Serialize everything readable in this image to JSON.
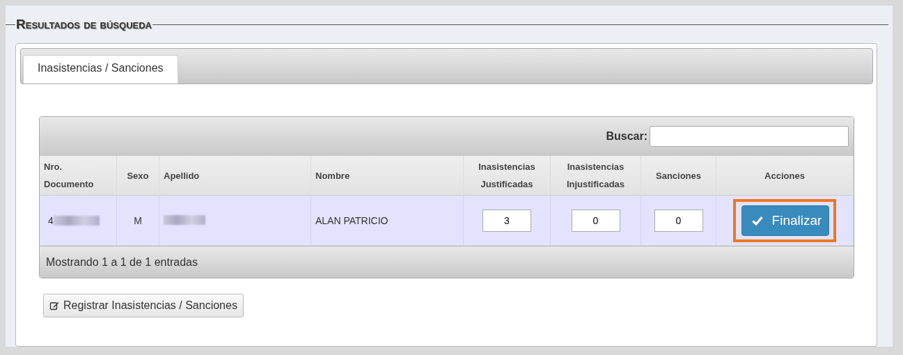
{
  "legend": "Resultados de búsqueda",
  "tabs": [
    {
      "label": "Inasistencias / Sanciones",
      "selected": true
    }
  ],
  "search": {
    "label": "Buscar:"
  },
  "table": {
    "columns": [
      "Nro. Documento",
      "Sexo",
      "Apellido",
      "Nombre",
      "Inasistencias Justificadas",
      "Inasistencias Injustificadas",
      "Sanciones",
      "Acciones"
    ],
    "rows": [
      {
        "documento": "4",
        "documento_redacted": true,
        "sexo": "M",
        "apellido_redacted": true,
        "nombre": "ALAN PATRICIO",
        "justificadas": "3",
        "injustificadas": "0",
        "sanciones": "0",
        "action": {
          "label": "Finalizar",
          "highlighted": true
        }
      }
    ]
  },
  "info": "Mostrando 1 a 1 de 1 entradas",
  "register_button": "Registrar Inasistencias / Sanciones"
}
